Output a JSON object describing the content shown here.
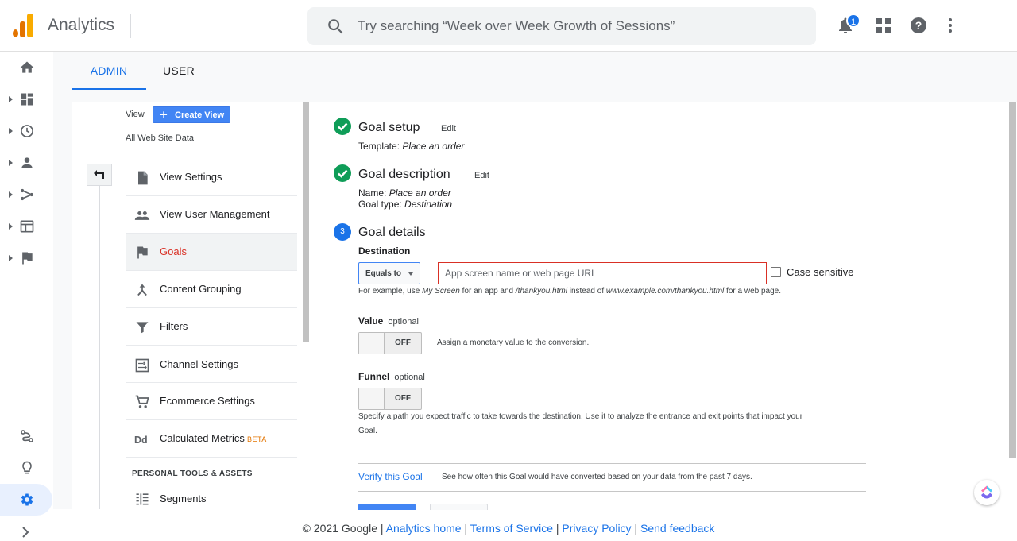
{
  "app": {
    "title": "Analytics"
  },
  "search": {
    "placeholder": "Try searching “Week over Week Growth of Sessions”"
  },
  "header": {
    "notification_count": "1"
  },
  "tabs": [
    {
      "label": "ADMIN",
      "active": true
    },
    {
      "label": "USER",
      "active": false
    }
  ],
  "view_panel": {
    "view_label": "View",
    "create_view_label": "Create View",
    "view_name": "All Web Site Data"
  },
  "nav_items": [
    {
      "label": "View Settings",
      "icon": "document-icon"
    },
    {
      "label": "View User Management",
      "icon": "people-icon"
    },
    {
      "label": "Goals",
      "icon": "flag-icon",
      "active": true
    },
    {
      "label": "Content Grouping",
      "icon": "merge-icon"
    },
    {
      "label": "Filters",
      "icon": "filter-icon"
    },
    {
      "label": "Channel Settings",
      "icon": "channel-icon"
    },
    {
      "label": "Ecommerce Settings",
      "icon": "cart-icon"
    },
    {
      "label": "Calculated Metrics",
      "icon": "dd-icon",
      "badge": "BETA"
    }
  ],
  "section_heading": "PERSONAL TOOLS & ASSETS",
  "segments_label": "Segments",
  "goal_setup": {
    "title": "Goal setup",
    "edit": "Edit",
    "template_label": "Template:",
    "template_value": "Place an order"
  },
  "goal_description": {
    "title": "Goal description",
    "edit": "Edit",
    "name_label": "Name:",
    "name_value": "Place an order",
    "type_label": "Goal type:",
    "type_value": "Destination"
  },
  "goal_details": {
    "step_number": "3",
    "title": "Goal details",
    "destination_label": "Destination",
    "match_type": "Equals to",
    "destination_placeholder": "App screen name or web page URL",
    "case_sensitive_label": "Case sensitive",
    "case_sensitive_checked": false,
    "hint_parts": [
      "For example, use ",
      "My Screen",
      " for an app and ",
      "/thankyou.html",
      " instead of ",
      "www.example.com/thankyou.html",
      " for a web page."
    ],
    "value_label": "Value",
    "value_optional": "optional",
    "value_toggle": "OFF",
    "value_desc": "Assign a monetary value to the conversion.",
    "funnel_label": "Funnel",
    "funnel_optional": "optional",
    "funnel_toggle": "OFF",
    "funnel_desc_line1": "Specify a path you expect traffic to take towards the destination. Use it to analyze the entrance and exit points that impact your",
    "funnel_desc_line2": "Goal.",
    "verify_link": "Verify this Goal",
    "verify_desc": "See how often this Goal would have converted based on your data from the past 7 days."
  },
  "footer": {
    "copyright": "© 2021 Google",
    "links": [
      "Analytics home",
      "Terms of Service",
      "Privacy Policy",
      "Send feedback"
    ],
    "separator": "|"
  },
  "colors": {
    "accent": "#1a73e8",
    "success": "#0f9d58",
    "error": "#d93025",
    "beta": "#e37400"
  }
}
